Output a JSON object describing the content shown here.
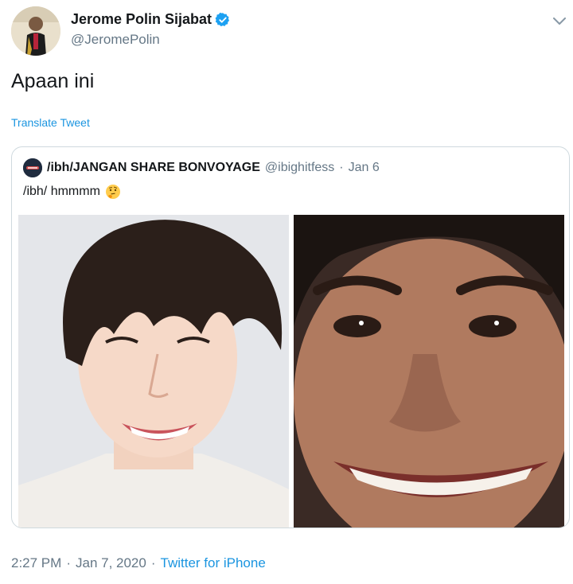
{
  "author": {
    "display_name": "Jerome Polin Sijabat",
    "handle": "@JeromePolin",
    "verified_icon": "verified-badge-icon"
  },
  "tweet": {
    "text": "Apaan ini",
    "translate_label": "Translate Tweet"
  },
  "quoted": {
    "display_name": "/ibh/JANGAN SHARE BONVOYAGE",
    "handle": "@ibighitfess",
    "separator": "·",
    "date": "Jan 6",
    "text": "/ibh/ hmmmm",
    "emoji": "thinking-face-icon"
  },
  "meta": {
    "time": "2:27 PM",
    "sep1": "·",
    "date": "Jan 7, 2020",
    "sep2": "·",
    "source": "Twitter for iPhone"
  },
  "colors": {
    "link": "#1b95e0",
    "secondary_text": "#657786",
    "border": "#cfd9de"
  }
}
